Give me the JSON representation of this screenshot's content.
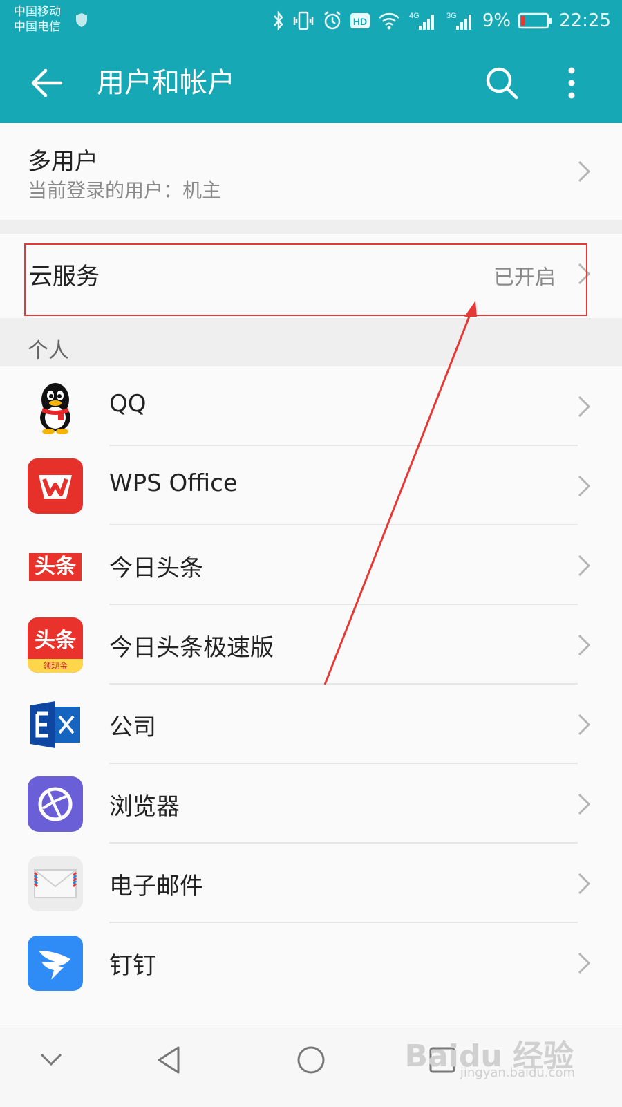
{
  "status_bar": {
    "carrier_1": "中国移动",
    "carrier_2": "中国电信",
    "net_1": "4G",
    "net_2": "3G",
    "battery": "9%",
    "time": "22:25",
    "hd": "HD",
    "icons": [
      "shield-icon",
      "bluetooth-icon",
      "vibrate-icon",
      "alarm-icon",
      "hd-icon",
      "wifi-icon",
      "signal-icon",
      "battery-icon"
    ]
  },
  "toolbar": {
    "title": "用户和帐户",
    "accent": "#17a8b5"
  },
  "multi_user": {
    "title": "多用户",
    "subtitle": "当前登录的用户：机主"
  },
  "cloud_service": {
    "title": "云服务",
    "status": "已开启"
  },
  "personal": {
    "section_title": "个人",
    "apps": [
      {
        "label": "QQ",
        "icon": "qq-icon"
      },
      {
        "label": "WPS Office",
        "icon": "wps-office-icon"
      },
      {
        "label": "今日头条",
        "icon": "toutiao-icon"
      },
      {
        "label": "今日头条极速版",
        "icon": "toutiao-lite-icon"
      },
      {
        "label": "公司",
        "icon": "exchange-icon"
      },
      {
        "label": "浏览器",
        "icon": "browser-icon"
      },
      {
        "label": "电子邮件",
        "icon": "email-icon"
      },
      {
        "label": "钉钉",
        "icon": "dingtalk-icon"
      }
    ]
  },
  "icon_text": {
    "toutiao": "头条",
    "toutiao_lite": "头条",
    "toutiao_lite_badge": "领现金"
  },
  "watermark": {
    "main": "Baidu 经验",
    "sub": "jingyan.baidu.com"
  },
  "annotation_color": "#e53935"
}
